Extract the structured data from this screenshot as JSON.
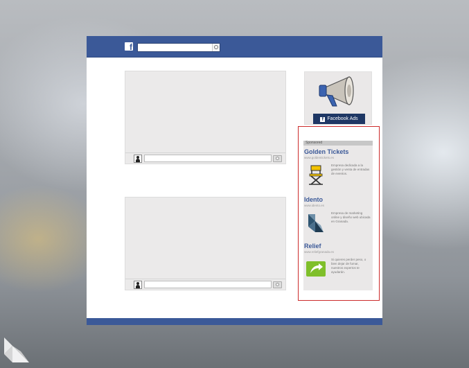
{
  "header": {
    "logo_letter": "f",
    "search_placeholder": ""
  },
  "posts": [
    {
      "comment_placeholder": ""
    },
    {
      "comment_placeholder": ""
    }
  ],
  "ad_banner": {
    "label": "Facebook Ads",
    "icon": "megaphone-icon"
  },
  "sponsored": {
    "heading": "Sponsored",
    "ads": [
      {
        "title": "Golden Tickets",
        "url": "www.goldentickets.es",
        "description": "Empresa dedicada a la gestión y venta de entradas de eventos.",
        "icon": "directors-chair-icon"
      },
      {
        "title": "Idento",
        "url": "www.idento.es",
        "description": "Empresa de marketing online y diseño web ubicada en Granada.",
        "icon": "origami-bird-icon"
      },
      {
        "title": "Relief",
        "url": "www.reliefgranada.es",
        "description": "Si quieres perder peso, o bien dejar de fumar, nuestros expertos te ayudarán.",
        "icon": "arrow-badge-icon"
      }
    ]
  },
  "colors": {
    "brand_blue": "#3b5998",
    "highlight_frame": "#cc2b2b"
  }
}
